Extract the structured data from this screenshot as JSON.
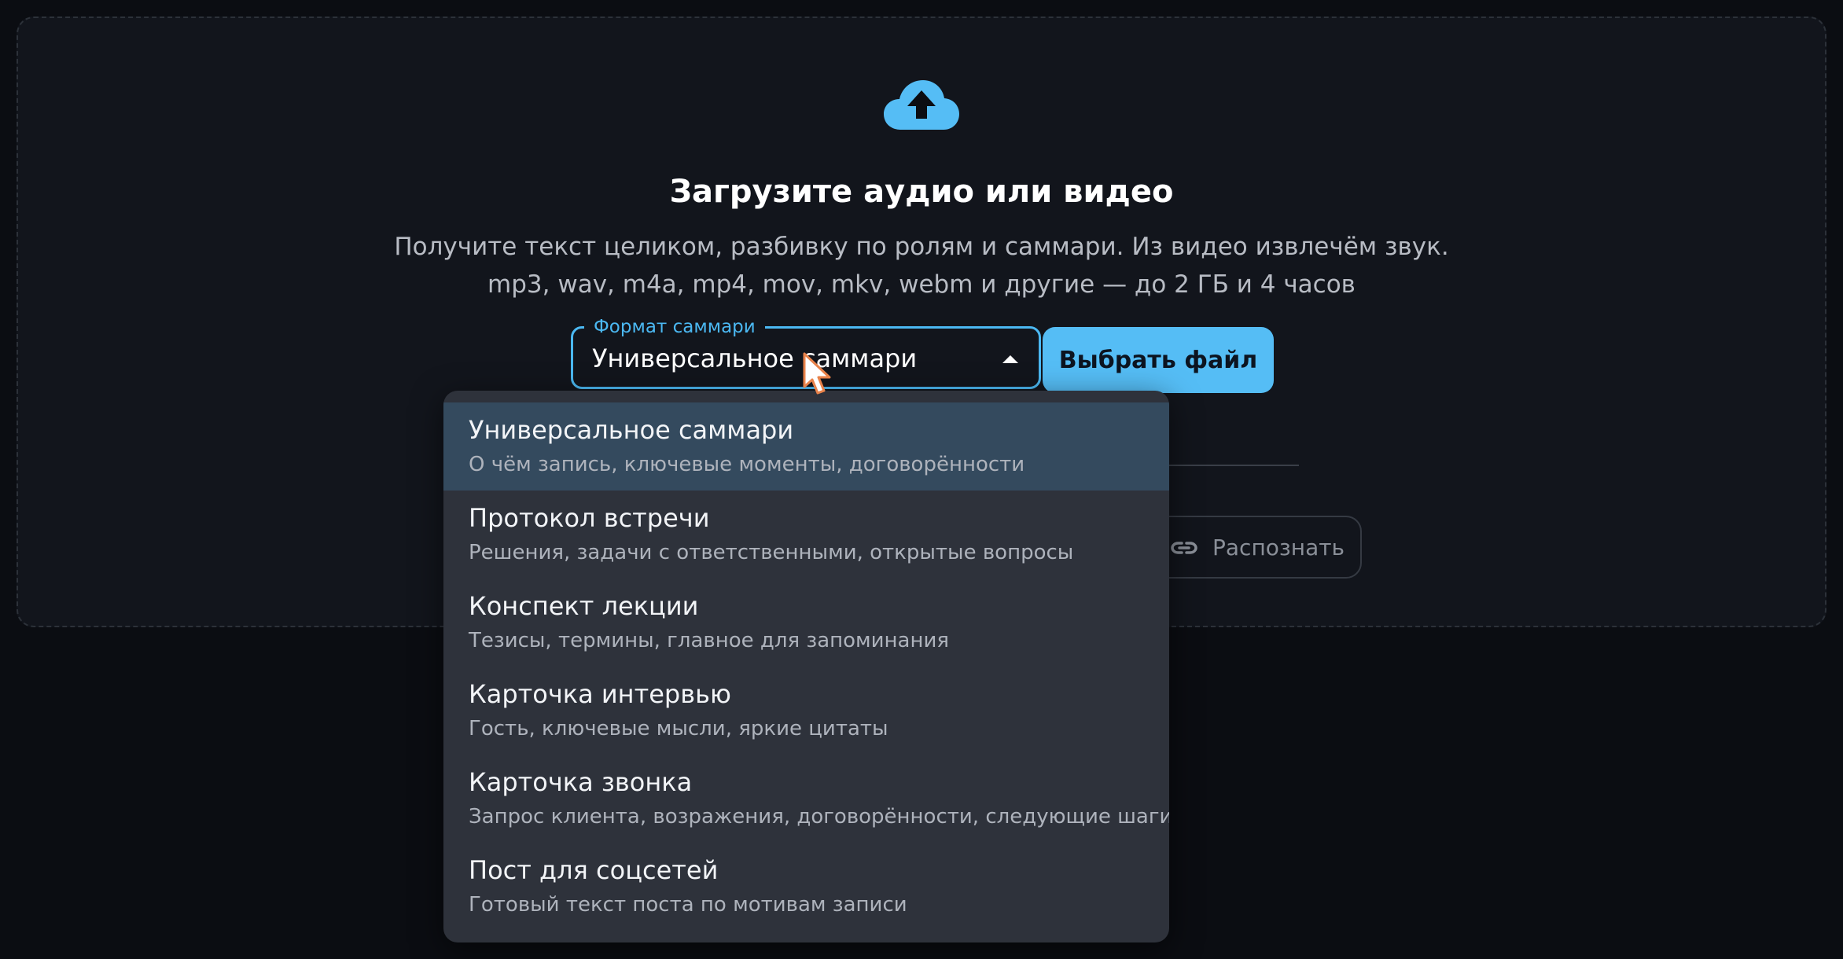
{
  "upload": {
    "icon": "cloud-upload-icon",
    "title": "Загрузите аудио или видео",
    "subtitle_line1": "Получите текст целиком, разбивку по ролям и саммари. Из видео извлечём звук.",
    "subtitle_line2": "mp3, wav, m4a, mp4, mov, mkv, webm и другие — до 2 ГБ и 4 часов"
  },
  "format_select": {
    "label": "Формат саммари",
    "value": "Универсальное саммари",
    "caret_icon": "caret-up-icon"
  },
  "choose_file_button": "Выбрать файл",
  "recognize_button": {
    "icon": "link-icon",
    "label": "Распознать"
  },
  "dropdown": {
    "selected_index": 0,
    "options": [
      {
        "title": "Универсальное саммари",
        "description": "О чём запись, ключевые моменты, договорённости"
      },
      {
        "title": "Протокол встречи",
        "description": "Решения, задачи с ответственными, открытые вопросы"
      },
      {
        "title": "Конспект лекции",
        "description": "Тезисы, термины, главное для запоминания"
      },
      {
        "title": "Карточка интервью",
        "description": "Гость, ключевые мысли, яркие цитаты"
      },
      {
        "title": "Карточка звонка",
        "description": "Запрос клиента, возражения, договорённости, следующие шаги"
      },
      {
        "title": "Пост для соцсетей",
        "description": "Готовый текст поста по мотивам записи"
      }
    ]
  },
  "colors": {
    "accent": "#4bb8f2",
    "button": "#55bdf5",
    "background": "#0b0d12",
    "card": "#12151c",
    "menu": "#2e323b",
    "menu_selected": "#344a5e"
  }
}
